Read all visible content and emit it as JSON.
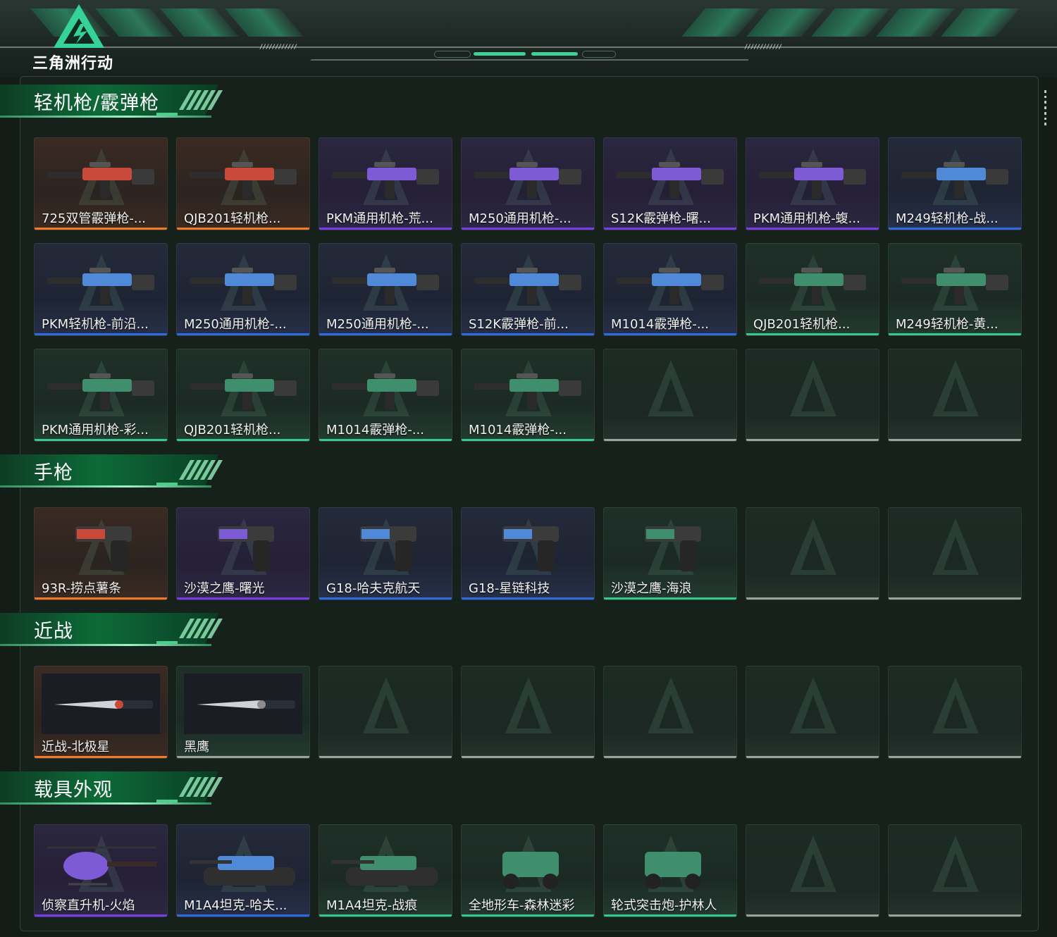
{
  "app": {
    "logo_text": "三角洲行动"
  },
  "colors": {
    "orange": "#f07a25",
    "purple": "#7a3ce6",
    "blue": "#2f6be0",
    "green": "#35c98d",
    "gray": "#9aa39e"
  },
  "sections": [
    {
      "title": "轻机枪/霰弹枪",
      "cards": [
        {
          "label": "725双管霰弹枪-...",
          "rarity": "orange",
          "icon": "shotgun-icon"
        },
        {
          "label": "QJB201轻机枪...",
          "rarity": "orange",
          "icon": "machine-gun-icon"
        },
        {
          "label": "PKM通用机枪-荒...",
          "rarity": "purple",
          "icon": "machine-gun-icon"
        },
        {
          "label": "M250通用机枪-...",
          "rarity": "purple",
          "icon": "machine-gun-icon"
        },
        {
          "label": "S12K霰弹枪-曙...",
          "rarity": "purple",
          "icon": "shotgun-icon"
        },
        {
          "label": "PKM通用机枪-蝮...",
          "rarity": "purple",
          "icon": "machine-gun-icon"
        },
        {
          "label": "M249轻机枪-战...",
          "rarity": "blue",
          "icon": "machine-gun-icon"
        },
        {
          "label": "PKM轻机枪-前沿...",
          "rarity": "blue",
          "icon": "machine-gun-icon"
        },
        {
          "label": "M250通用机枪-...",
          "rarity": "blue",
          "icon": "machine-gun-icon"
        },
        {
          "label": "M250通用机枪-...",
          "rarity": "blue",
          "icon": "machine-gun-icon"
        },
        {
          "label": "S12K霰弹枪-前...",
          "rarity": "blue",
          "icon": "shotgun-icon"
        },
        {
          "label": "M1014霰弹枪-...",
          "rarity": "blue",
          "icon": "shotgun-icon"
        },
        {
          "label": "QJB201轻机枪...",
          "rarity": "green",
          "icon": "machine-gun-icon"
        },
        {
          "label": "M249轻机枪-黄...",
          "rarity": "green",
          "icon": "machine-gun-icon"
        },
        {
          "label": "PKM通用机枪-彩...",
          "rarity": "green",
          "icon": "machine-gun-icon"
        },
        {
          "label": "QJB201轻机枪...",
          "rarity": "green",
          "icon": "machine-gun-icon"
        },
        {
          "label": "M1014霰弹枪-...",
          "rarity": "green",
          "icon": "shotgun-icon"
        },
        {
          "label": "M1014霰弹枪-...",
          "rarity": "green",
          "icon": "shotgun-icon"
        },
        {
          "label": "",
          "rarity": "empty"
        },
        {
          "label": "",
          "rarity": "empty"
        },
        {
          "label": "",
          "rarity": "empty"
        }
      ]
    },
    {
      "title": "手枪",
      "cards": [
        {
          "label": "93R-捞点薯条",
          "rarity": "orange",
          "icon": "pistol-icon"
        },
        {
          "label": "沙漠之鹰-曙光",
          "rarity": "purple",
          "icon": "pistol-icon"
        },
        {
          "label": "G18-哈夫克航天",
          "rarity": "blue",
          "icon": "pistol-icon"
        },
        {
          "label": "G18-星链科技",
          "rarity": "blue",
          "icon": "pistol-icon"
        },
        {
          "label": "沙漠之鹰-海浪",
          "rarity": "green",
          "icon": "pistol-icon"
        },
        {
          "label": "",
          "rarity": "empty"
        },
        {
          "label": "",
          "rarity": "empty"
        }
      ]
    },
    {
      "title": "近战",
      "cards": [
        {
          "label": "近战-北极星",
          "rarity": "orange",
          "icon": "knife-icon"
        },
        {
          "label": "黑鹰",
          "rarity": "gray",
          "icon": "knife-icon"
        },
        {
          "label": "",
          "rarity": "empty"
        },
        {
          "label": "",
          "rarity": "empty"
        },
        {
          "label": "",
          "rarity": "empty"
        },
        {
          "label": "",
          "rarity": "empty"
        },
        {
          "label": "",
          "rarity": "empty"
        }
      ]
    },
    {
      "title": "载具外观",
      "cards": [
        {
          "label": "侦察直升机-火焰",
          "rarity": "purple",
          "icon": "helicopter-icon"
        },
        {
          "label": "M1A4坦克-哈夫...",
          "rarity": "blue",
          "icon": "tank-icon"
        },
        {
          "label": "M1A4坦克-战痕",
          "rarity": "green",
          "icon": "tank-icon"
        },
        {
          "label": "全地形车-森林迷彩",
          "rarity": "green",
          "icon": "atv-icon"
        },
        {
          "label": "轮式突击炮-护林人",
          "rarity": "green",
          "icon": "armored-car-icon"
        },
        {
          "label": "",
          "rarity": "empty"
        },
        {
          "label": "",
          "rarity": "empty"
        }
      ]
    }
  ]
}
